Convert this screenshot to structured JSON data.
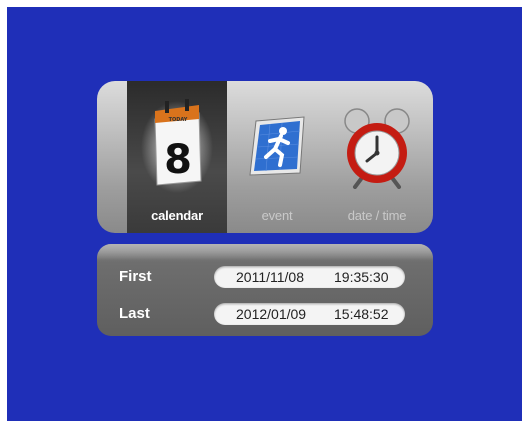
{
  "menu": {
    "items": [
      {
        "label": "calendar",
        "selected": true,
        "icon": "calendar-icon",
        "icon_day": "8",
        "icon_caption": "TODAY"
      },
      {
        "label": "event",
        "selected": false,
        "icon": "running-person-icon"
      },
      {
        "label": "date / time",
        "selected": false,
        "icon": "alarm-clock-icon"
      }
    ]
  },
  "records": {
    "first": {
      "label": "First",
      "date": "2011/11/08",
      "time": "19:35:30"
    },
    "last": {
      "label": "Last",
      "date": "2012/01/09",
      "time": "15:48:52"
    }
  },
  "colors": {
    "background": "#1f2fb8",
    "panel": "#9e9e9e",
    "selected": "#3a3a3a",
    "field": "#f4f4f4"
  }
}
